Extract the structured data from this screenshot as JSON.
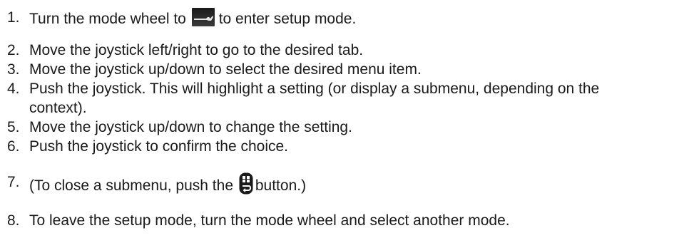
{
  "steps": [
    {
      "num": "1.",
      "before": "Turn the mode wheel to",
      "icon": "setup-wrench-icon",
      "after": "to enter setup mode."
    },
    {
      "num": "2.",
      "text": "Move the joystick left/right to go to the desired tab."
    },
    {
      "num": "3.",
      "text": "Move the joystick up/down to select the desired menu item."
    },
    {
      "num": "4.",
      "line1": "Push the joystick. This will highlight a setting (or display a submenu, depending on the",
      "line2": "context)."
    },
    {
      "num": "5.",
      "text": "Move the joystick up/down to change the setting."
    },
    {
      "num": "6.",
      "text": "Push the joystick to confirm the choice."
    },
    {
      "num": "7.",
      "before": "(To close a submenu, push the",
      "icon": "menu-back-button-icon",
      "after": "button.)"
    },
    {
      "num": "8.",
      "text": "To leave the setup mode, turn the mode wheel and select another mode."
    }
  ]
}
